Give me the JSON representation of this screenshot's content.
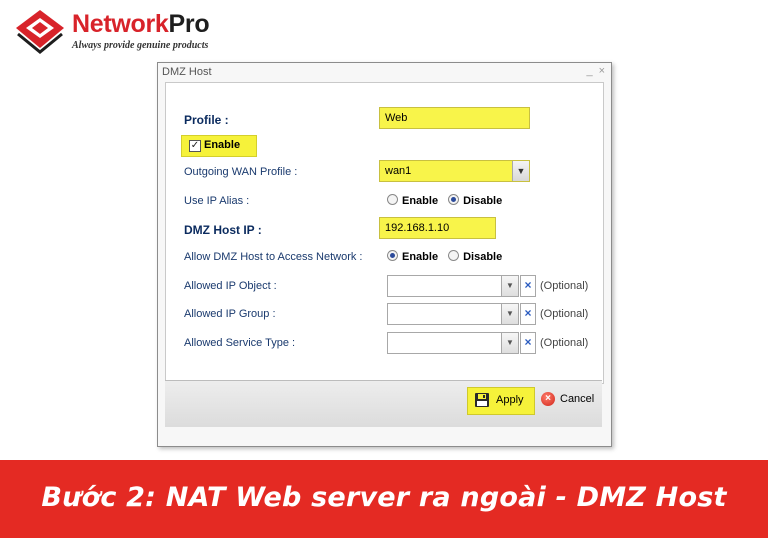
{
  "brand": {
    "name_part1": "Network",
    "name_part2": "Pro",
    "tagline": "Always provide genuine products",
    "accent_color": "#d8232a"
  },
  "window": {
    "title": "DMZ Host",
    "controls": [
      "_",
      "×"
    ]
  },
  "form": {
    "profile_label": "Profile :",
    "profile_value": "Web",
    "enable_label": "Enable",
    "enable_checked": true,
    "wan_label": "Outgoing WAN Profile :",
    "wan_value": "wan1",
    "ip_alias_label": "Use IP Alias :",
    "ip_alias_options": [
      "Enable",
      "Disable"
    ],
    "ip_alias_selected": "Disable",
    "dmz_ip_label": "DMZ Host IP :",
    "dmz_ip_value": "192.168.1.10",
    "access_label": "Allow DMZ Host to Access Network :",
    "access_options": [
      "Enable",
      "Disable"
    ],
    "access_selected": "Enable",
    "ip_object_label": "Allowed IP Object :",
    "ip_group_label": "Allowed IP Group :",
    "service_type_label": "Allowed Service Type :",
    "optional_text": "(Optional)"
  },
  "footer": {
    "apply_label": "Apply",
    "cancel_label": "Cancel"
  },
  "highlight_color": "#f6f23a",
  "banner": {
    "text": "Bước 2: NAT Web server ra ngoài - DMZ Host",
    "color": "#e42a23"
  }
}
